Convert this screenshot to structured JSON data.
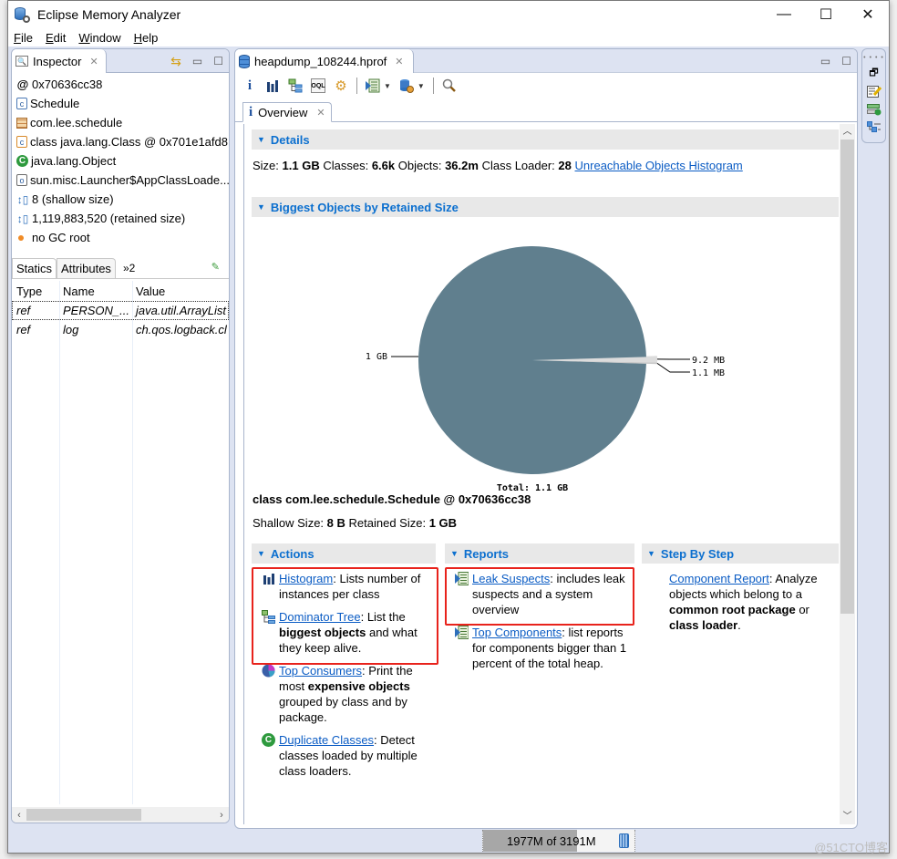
{
  "window": {
    "title": "Eclipse Memory Analyzer",
    "controls": {
      "minimize": "—",
      "maximize": "☐",
      "close": "✕"
    }
  },
  "menu": [
    {
      "label": "File",
      "mnemonic": "F",
      "rest": "ile"
    },
    {
      "label": "Edit",
      "mnemonic": "E",
      "rest": "dit"
    },
    {
      "label": "Window",
      "mnemonic": "W",
      "rest": "indow"
    },
    {
      "label": "Help",
      "mnemonic": "H",
      "rest": "elp"
    }
  ],
  "inspector": {
    "tab_label": "Inspector",
    "rows": [
      {
        "icon": "at-icon",
        "text": "0x70636cc38"
      },
      {
        "icon": "class-icon",
        "text": "Schedule"
      },
      {
        "icon": "package-icon",
        "text": "com.lee.schedule"
      },
      {
        "icon": "class-object-icon",
        "text": "class java.lang.Class @ 0x701e1afd8"
      },
      {
        "icon": "superclass-icon",
        "text": "java.lang.Object"
      },
      {
        "icon": "classloader-icon",
        "text": "sun.misc.Launcher$AppClassLoade..."
      },
      {
        "icon": "size-icon",
        "text": "8 (shallow size)"
      },
      {
        "icon": "size-icon",
        "text": "1,119,883,520 (retained size)"
      },
      {
        "icon": "gc-root-icon",
        "text": "no GC root"
      }
    ],
    "sub_tabs": [
      "Statics",
      "Attributes"
    ],
    "sub_tabs_more": "»2",
    "table": {
      "headers": [
        "Type",
        "Name",
        "Value"
      ],
      "rows": [
        [
          "ref",
          "PERSON_...",
          "java.util.ArrayList"
        ],
        [
          "ref",
          "log",
          "ch.qos.logback.cl"
        ]
      ]
    }
  },
  "editor": {
    "tab_label": "heapdump_108244.hprof",
    "toolbar": [
      "overview-info",
      "histogram",
      "dominator-tree",
      "oql",
      "thread-overview",
      "run-report",
      "query-browser",
      "search"
    ],
    "inner_tab": "Overview",
    "details": {
      "header": "Details",
      "size_label": "Size:",
      "size": "1.1 GB",
      "classes_label": "Classes:",
      "classes": "6.6k",
      "objects_label": "Objects:",
      "objects": "36.2m",
      "loader_label": "Class Loader:",
      "loader": "28",
      "link": "Unreachable Objects Histogram"
    },
    "biggest_header": "Biggest Objects by Retained Size",
    "selected_object": {
      "title": "class com.lee.schedule.Schedule @ 0x70636cc38",
      "shallow_label": "Shallow Size:",
      "shallow": "8 B",
      "retained_label": "Retained Size:",
      "retained": "1 GB"
    },
    "actions": {
      "header": "Actions",
      "items": [
        {
          "link": "Histogram",
          "pre": ": Lists number of instances per class",
          "bold": "",
          "post": ""
        },
        {
          "link": "Dominator Tree",
          "pre": ": List the ",
          "bold": "biggest objects",
          "post": " and what they keep alive."
        },
        {
          "link": "Top Consumers",
          "pre": ": Print the most ",
          "bold": "expensive objects",
          "post": " grouped by class and by package."
        },
        {
          "link": "Duplicate Classes",
          "pre": ": Detect classes loaded by multiple class loaders.",
          "bold": "",
          "post": ""
        }
      ]
    },
    "reports": {
      "header": "Reports",
      "items": [
        {
          "link": "Leak Suspects",
          "pre": ": includes leak suspects and a system overview"
        },
        {
          "link": "Top Components",
          "pre": ": list reports for components bigger than 1 percent of the total heap."
        }
      ]
    },
    "step_by_step": {
      "header": "Step By Step",
      "link": "Component Report",
      "pre": ": Analyze objects which belong to a ",
      "bold1": "common root package",
      "mid": " or ",
      "bold2": "class loader",
      "post": "."
    }
  },
  "chart_data": {
    "type": "pie",
    "title": "",
    "total_label": "Total: 1.1 GB",
    "slices": [
      {
        "label": "1 GB",
        "value_mb": 1068.0,
        "color": "#607f8e"
      },
      {
        "label": "9.2 MB",
        "value_mb": 9.2,
        "color": "#dcdcdc"
      },
      {
        "label": "1.1 MB",
        "value_mb": 1.1,
        "color": "#c8c8c8"
      }
    ]
  },
  "status": {
    "heap_text": "1977M of 3191M",
    "heap_used_mb": 1977,
    "heap_total_mb": 3191
  },
  "watermark": "@51CTO博客"
}
